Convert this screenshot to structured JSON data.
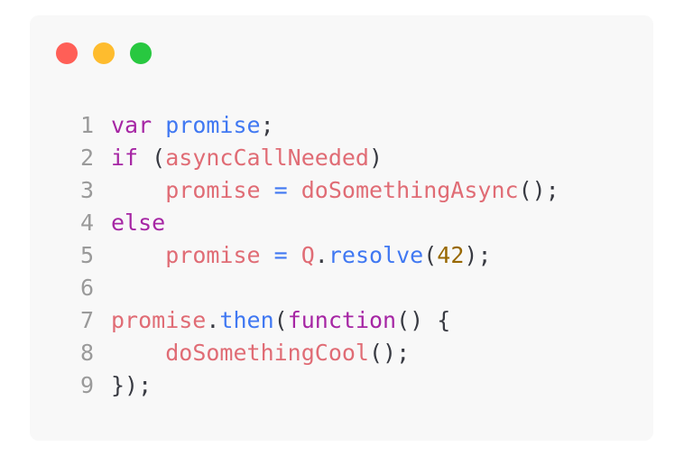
{
  "window": {
    "controls": [
      {
        "name": "close-dot",
        "color": "#ff5f57"
      },
      {
        "name": "minimize-dot",
        "color": "#febc2e"
      },
      {
        "name": "maximize-dot",
        "color": "#28c840"
      }
    ]
  },
  "colors": {
    "keyword": "#a626a4",
    "variable": "#e06c75",
    "function": "#4078f2",
    "number": "#986801",
    "plain": "#383a42",
    "line_number": "#9a9a9a"
  },
  "code": {
    "lines": [
      {
        "num": "1",
        "tokens": [
          {
            "t": "var",
            "c": "keyword"
          },
          {
            "t": " ",
            "c": "plain"
          },
          {
            "t": "promise",
            "c": "function"
          },
          {
            "t": ";",
            "c": "plain"
          }
        ]
      },
      {
        "num": "2",
        "tokens": [
          {
            "t": "if",
            "c": "keyword"
          },
          {
            "t": " (",
            "c": "plain"
          },
          {
            "t": "asyncCallNeeded",
            "c": "variable"
          },
          {
            "t": ")",
            "c": "plain"
          }
        ]
      },
      {
        "num": "3",
        "tokens": [
          {
            "t": "    ",
            "c": "plain"
          },
          {
            "t": "promise",
            "c": "variable"
          },
          {
            "t": " = ",
            "c": "function"
          },
          {
            "t": "doSomethingAsync",
            "c": "variable"
          },
          {
            "t": "();",
            "c": "plain"
          }
        ]
      },
      {
        "num": "4",
        "tokens": [
          {
            "t": "else",
            "c": "keyword"
          }
        ]
      },
      {
        "num": "5",
        "tokens": [
          {
            "t": "    ",
            "c": "plain"
          },
          {
            "t": "promise",
            "c": "variable"
          },
          {
            "t": " = ",
            "c": "function"
          },
          {
            "t": "Q",
            "c": "variable"
          },
          {
            "t": ".",
            "c": "plain"
          },
          {
            "t": "resolve",
            "c": "function"
          },
          {
            "t": "(",
            "c": "plain"
          },
          {
            "t": "42",
            "c": "number"
          },
          {
            "t": ");",
            "c": "plain"
          }
        ]
      },
      {
        "num": "6",
        "tokens": []
      },
      {
        "num": "7",
        "tokens": [
          {
            "t": "promise",
            "c": "variable"
          },
          {
            "t": ".",
            "c": "plain"
          },
          {
            "t": "then",
            "c": "function"
          },
          {
            "t": "(",
            "c": "plain"
          },
          {
            "t": "function",
            "c": "keyword"
          },
          {
            "t": "() {",
            "c": "plain"
          }
        ]
      },
      {
        "num": "8",
        "tokens": [
          {
            "t": "    ",
            "c": "plain"
          },
          {
            "t": "doSomethingCool",
            "c": "variable"
          },
          {
            "t": "();",
            "c": "plain"
          }
        ]
      },
      {
        "num": "9",
        "tokens": [
          {
            "t": "});",
            "c": "plain"
          }
        ]
      }
    ]
  }
}
